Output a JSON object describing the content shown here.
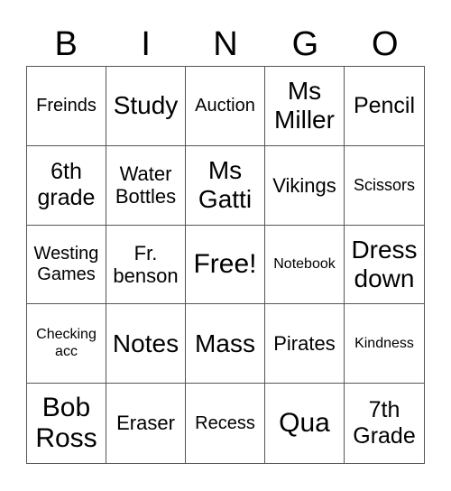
{
  "header": [
    "B",
    "I",
    "N",
    "G",
    "O"
  ],
  "cells": [
    [
      "Freinds",
      "Study",
      "Auction",
      "Ms Miller",
      "Pencil"
    ],
    [
      "6th grade",
      "Water Bottles",
      "Ms Gatti",
      "Vikings",
      "Scissors"
    ],
    [
      "Westing Games",
      "Fr. benson",
      "Free!",
      "Notebook",
      "Dress down"
    ],
    [
      "Checking acc",
      "Notes",
      "Mass",
      "Pirates",
      "Kindness"
    ],
    [
      "Bob Ross",
      "Eraser",
      "Recess",
      "Qua",
      "7th Grade"
    ]
  ]
}
